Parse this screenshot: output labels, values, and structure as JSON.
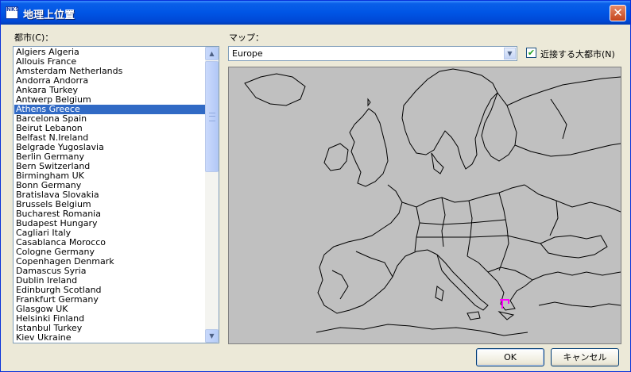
{
  "window": {
    "title": "地理上位置",
    "icon_text": "NKS",
    "close_glyph": "✕"
  },
  "city_list": {
    "label": "都市(C)：",
    "selected_index": 6,
    "items": [
      "Algiers Algeria",
      "Allouis France",
      "Amsterdam Netherlands",
      "Andorra Andorra",
      "Ankara Turkey",
      "Antwerp Belgium",
      "Athens Greece",
      "Barcelona Spain",
      "Beirut Lebanon",
      "Belfast N.Ireland",
      "Belgrade Yugoslavia",
      "Berlin Germany",
      "Bern Switzerland",
      "Birmingham UK",
      "Bonn Germany",
      "Bratislava Slovakia",
      "Brussels Belgium",
      "Bucharest Romania",
      "Budapest Hungary",
      "Cagliari Italy",
      "Casablanca Morocco",
      "Cologne Germany",
      "Copenhagen Denmark",
      "Damascus Syria",
      "Dublin Ireland",
      "Edinburgh Scotland",
      "Frankfurt Germany",
      "Glasgow UK",
      "Helsinki Finland",
      "Istanbul Turkey",
      "Kiev Ukraine"
    ]
  },
  "map_select": {
    "label": "マップ：",
    "value": "Europe"
  },
  "nearby_city": {
    "label": "近接する大都市(N)",
    "checked": true
  },
  "buttons": {
    "ok": "OK",
    "cancel": "キャンセル"
  },
  "icons": {
    "scroll_up": "▲",
    "scroll_down": "▼",
    "combo_arrow": "▼",
    "check": "✔"
  },
  "colors": {
    "titlebar": "#0055e5",
    "selection": "#316ac5",
    "map_background": "#c0c0c0",
    "marker": "#ff00ff"
  }
}
